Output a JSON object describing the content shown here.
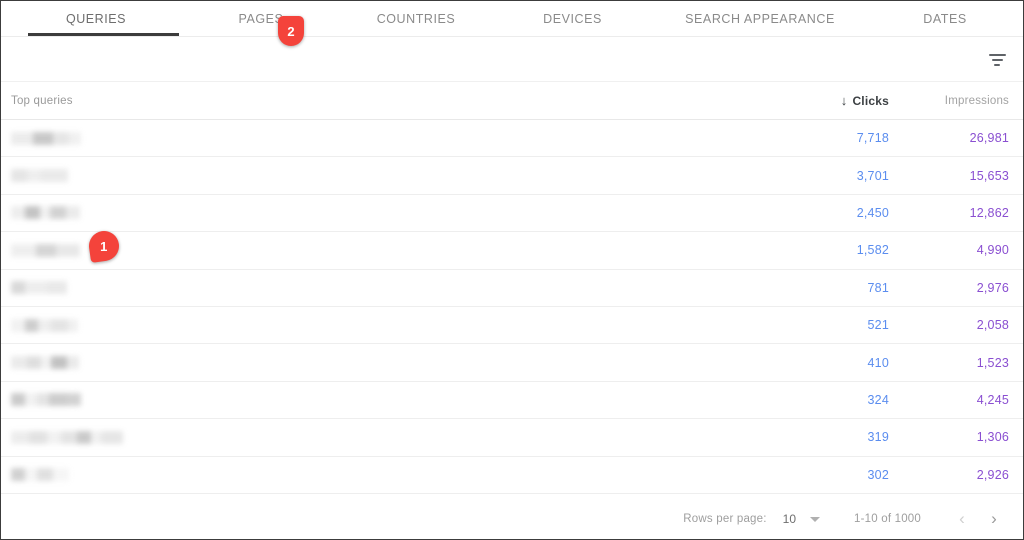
{
  "tabs": [
    {
      "label": "QUERIES",
      "active": true,
      "width_class": "w-queries"
    },
    {
      "label": "PAGES",
      "active": false,
      "width_class": "w-pages"
    },
    {
      "label": "COUNTRIES",
      "active": false,
      "width_class": "w-countries"
    },
    {
      "label": "DEVICES",
      "active": false,
      "width_class": "w-devices"
    },
    {
      "label": "SEARCH APPEARANCE",
      "active": false,
      "width_class": "w-search"
    },
    {
      "label": "DATES",
      "active": false,
      "width_class": "w-dates"
    }
  ],
  "toolbar": {
    "filter_icon": "filter-icon"
  },
  "table": {
    "columns": {
      "query": "Top queries",
      "clicks": "Clicks",
      "impressions": "Impressions",
      "sort_arrow": "↓",
      "sorted_by": "clicks",
      "sort_direction": "desc"
    },
    "rows": [
      {
        "query_redacted": true,
        "clicks": "7,718",
        "impressions": "26,981",
        "blur_width": 70,
        "segments": [
          [
            22,
            "#eaeaea"
          ],
          [
            20,
            "#c4c4c4"
          ],
          [
            16,
            "#e4e4e4"
          ],
          [
            12,
            "#efefef"
          ]
        ]
      },
      {
        "query_redacted": true,
        "clicks": "3,701",
        "impressions": "15,653",
        "blur_width": 57,
        "segments": [
          [
            16,
            "#e3e3e3"
          ],
          [
            14,
            "#ededed"
          ],
          [
            27,
            "#e8e8e8"
          ]
        ]
      },
      {
        "query_redacted": true,
        "clicks": "2,450",
        "impressions": "12,862",
        "blur_width": 69,
        "segments": [
          [
            14,
            "#ececec"
          ],
          [
            15,
            "#bfbfbf"
          ],
          [
            10,
            "#f0f0f0"
          ],
          [
            16,
            "#cfcfcf"
          ],
          [
            14,
            "#e9e9e9"
          ]
        ]
      },
      {
        "query_redacted": true,
        "clicks": "1,582",
        "impressions": "4,990",
        "blur_width": 69,
        "segments": [
          [
            25,
            "#ededed"
          ],
          [
            20,
            "#d2d2d2"
          ],
          [
            24,
            "#e6e6e6"
          ]
        ]
      },
      {
        "query_redacted": true,
        "clicks": "781",
        "impressions": "2,976",
        "blur_width": 56,
        "segments": [
          [
            14,
            "#d6d6d6"
          ],
          [
            22,
            "#ececec"
          ],
          [
            20,
            "#e7e7e7"
          ]
        ]
      },
      {
        "query_redacted": true,
        "clicks": "521",
        "impressions": "2,058",
        "blur_width": 67,
        "segments": [
          [
            14,
            "#f0f0f0"
          ],
          [
            13,
            "#c9c9c9"
          ],
          [
            13,
            "#ededed"
          ],
          [
            17,
            "#e2e2e2"
          ],
          [
            10,
            "#efefef"
          ]
        ]
      },
      {
        "query_redacted": true,
        "clicks": "410",
        "impressions": "1,523",
        "blur_width": 68,
        "segments": [
          [
            16,
            "#e9e9e9"
          ],
          [
            14,
            "#dcdcdc"
          ],
          [
            10,
            "#f1f1f1"
          ],
          [
            16,
            "#bdbdbd"
          ],
          [
            12,
            "#e8e8e8"
          ]
        ]
      },
      {
        "query_redacted": true,
        "clicks": "324",
        "impressions": "4,245",
        "blur_width": 70,
        "segments": [
          [
            14,
            "#c7c7c7"
          ],
          [
            12,
            "#f0f0f0"
          ],
          [
            12,
            "#e2e2e2"
          ],
          [
            18,
            "#c9c9c9"
          ],
          [
            14,
            "#cfcfcf"
          ]
        ]
      },
      {
        "query_redacted": true,
        "clicks": "319",
        "impressions": "1,306",
        "blur_width": 112,
        "segments": [
          [
            18,
            "#ebebeb"
          ],
          [
            18,
            "#e0e0e0"
          ],
          [
            14,
            "#f0f0f0"
          ],
          [
            16,
            "#e2e2e2"
          ],
          [
            14,
            "#c6c6c6"
          ],
          [
            10,
            "#f0f0f0"
          ],
          [
            22,
            "#e4e4e4"
          ]
        ]
      },
      {
        "query_redacted": true,
        "clicks": "302",
        "impressions": "2,926",
        "blur_width": 58,
        "segments": [
          [
            14,
            "#cdcdcd"
          ],
          [
            12,
            "#f4f4f4"
          ],
          [
            16,
            "#dedede"
          ],
          [
            16,
            "#f5f5f5"
          ]
        ]
      }
    ]
  },
  "footer": {
    "rows_per_page_label": "Rows per page:",
    "rows_per_page_value": "10",
    "range_label": "1-10 of 1000",
    "prev_icon": "‹",
    "next_icon": "›"
  },
  "annotations": [
    {
      "id": "1",
      "label": "1"
    },
    {
      "id": "2",
      "label": "2"
    }
  ],
  "colors": {
    "clicks": "#5b8def",
    "impressions": "#8a4fd1",
    "badge": "#f4433b",
    "tab_indicator": "#3c3c3c"
  }
}
